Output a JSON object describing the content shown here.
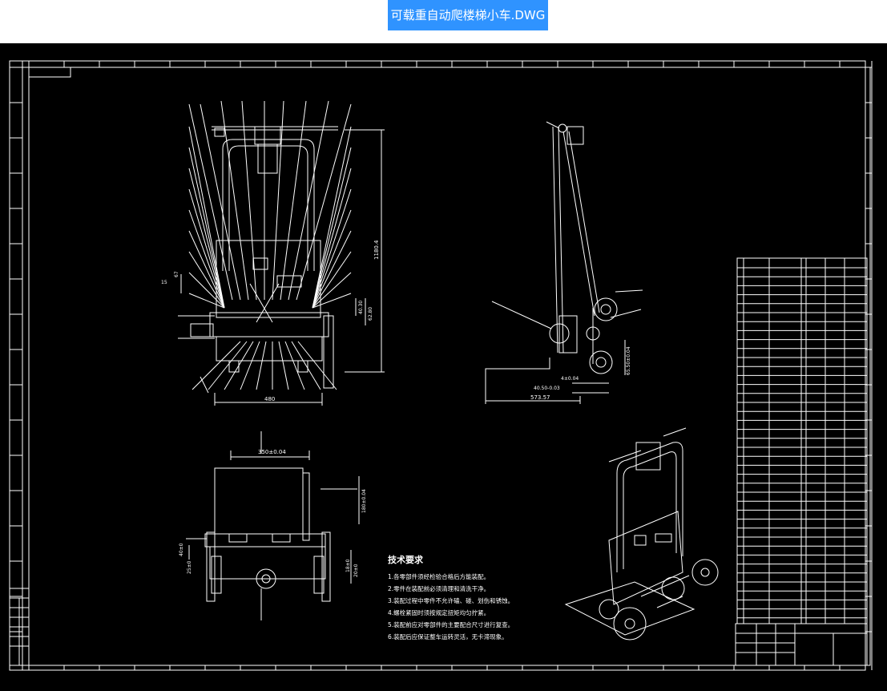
{
  "app": {
    "file_tab_title": "可载重自动爬楼梯小车.DWG"
  },
  "colors": {
    "canvas_bg": "#000000",
    "line": "#ffffff",
    "tab_bg": "#2f93ff",
    "tab_text": "#ffffff"
  },
  "drawing": {
    "front_view": {
      "dim_height": "1180.4",
      "dim_width": "480",
      "dim_right_1": "62.80",
      "dim_right_2": "40.30",
      "dim_left_1": "15",
      "dim_left_2": "67"
    },
    "side_view": {
      "dim_base": "573.57",
      "dim_wheel_1": "40.50-0.03",
      "dim_wheel_2": "4±0.04",
      "dim_vertical": "65.50±0.04"
    },
    "top_view": {
      "dim_top": "350±0.04",
      "dim_left_1": "40±0",
      "dim_left_2": "25±0",
      "dim_right_1": "180±0.04",
      "dim_right_2": "20±0",
      "dim_right_3": "18±0"
    },
    "tech_requirements": {
      "heading": "技术要求",
      "items": [
        "1.各零部件须经检验合格后方能装配。",
        "2.零件在装配前必须清理和清洗干净。",
        "3.装配过程中零件不允许磕、碰、划伤和锈蚀。",
        "4.螺栓紧固时须按规定扭矩均匀拧紧。",
        "5.装配前应对零部件的主要配合尺寸进行复查。",
        "6.装配后应保证整车运转灵活，无卡滞现象。"
      ]
    }
  }
}
